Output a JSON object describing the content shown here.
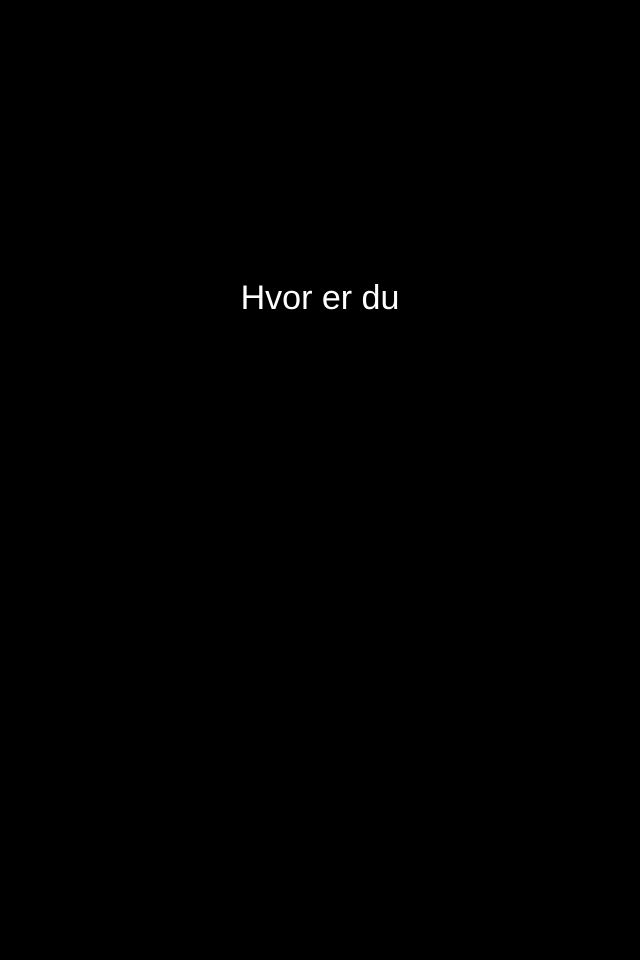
{
  "screen": {
    "message": "Hvor er du",
    "colors": {
      "background": "#000000",
      "text": "#ffffff"
    }
  }
}
